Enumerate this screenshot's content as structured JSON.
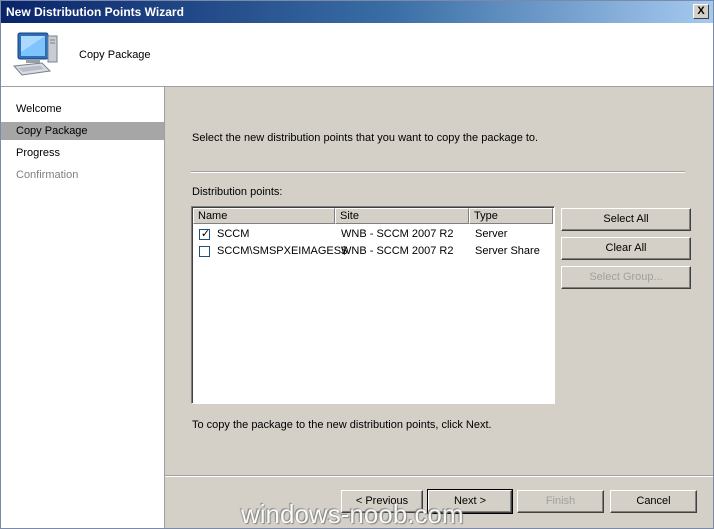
{
  "window": {
    "title": "New Distribution Points Wizard",
    "close_label": "X"
  },
  "header": {
    "title": "Copy Package"
  },
  "nav": {
    "items": [
      {
        "label": "Welcome",
        "state": "normal"
      },
      {
        "label": "Copy Package",
        "state": "active"
      },
      {
        "label": "Progress",
        "state": "normal"
      },
      {
        "label": "Confirmation",
        "state": "disabled"
      }
    ]
  },
  "main": {
    "instruction": "Select the new distribution points that you want to copy the package to.",
    "dp_label": "Distribution points:",
    "columns": [
      "Name",
      "Site",
      "Type"
    ],
    "rows": [
      {
        "checked": true,
        "name": "SCCM",
        "site": "WNB - SCCM 2007 R2",
        "type": "Server"
      },
      {
        "checked": false,
        "name": "SCCM\\SMSPXEIMAGES$",
        "site": "WNB - SCCM 2007 R2",
        "type": "Server Share"
      }
    ],
    "select_all": "Select All",
    "clear_all": "Clear All",
    "select_group": "Select Group...",
    "footer_text": "To copy the package to the new distribution points, click Next."
  },
  "buttons": {
    "previous": "< Previous",
    "next": "Next >",
    "finish": "Finish",
    "cancel": "Cancel"
  },
  "watermark": "windows-noob.com",
  "colors": {
    "titlebar_start": "#0a246a",
    "titlebar_end": "#a6caf0",
    "face": "#d4d0c8",
    "nav_active": "#a6a6a6"
  }
}
